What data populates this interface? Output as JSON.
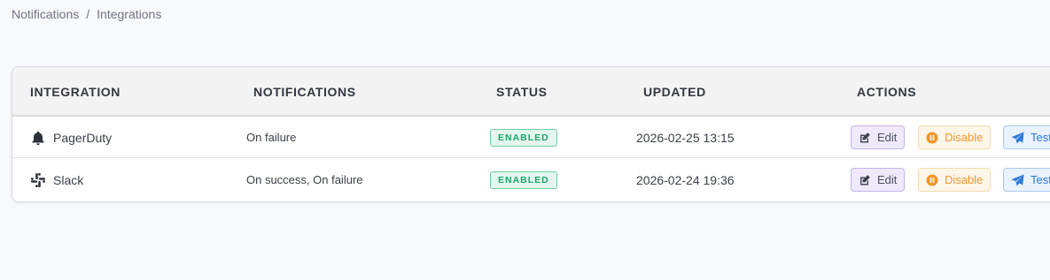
{
  "breadcrumb": {
    "items": [
      "Notifications",
      "Integrations"
    ],
    "separator": "/"
  },
  "table": {
    "columns": [
      "INTEGRATION",
      "NOTIFICATIONS",
      "STATUS",
      "UPDATED",
      "ACTIONS"
    ],
    "rows": [
      {
        "icon": "bell-icon",
        "integration": "PagerDuty",
        "notifications": "On failure",
        "status": "ENABLED",
        "updated": "2026-02-25 13:15",
        "actions": {
          "edit": "Edit",
          "disable": "Disable",
          "test": "Test"
        }
      },
      {
        "icon": "slack-icon",
        "integration": "Slack",
        "notifications": "On success, On failure",
        "status": "ENABLED",
        "updated": "2026-02-24 19:36",
        "actions": {
          "edit": "Edit",
          "disable": "Disable",
          "test": "Test"
        }
      }
    ]
  },
  "colors": {
    "status_enabled": "#1fa36a",
    "edit": "#8a6fd6",
    "disable": "#f0962a",
    "test": "#2b78dc"
  }
}
